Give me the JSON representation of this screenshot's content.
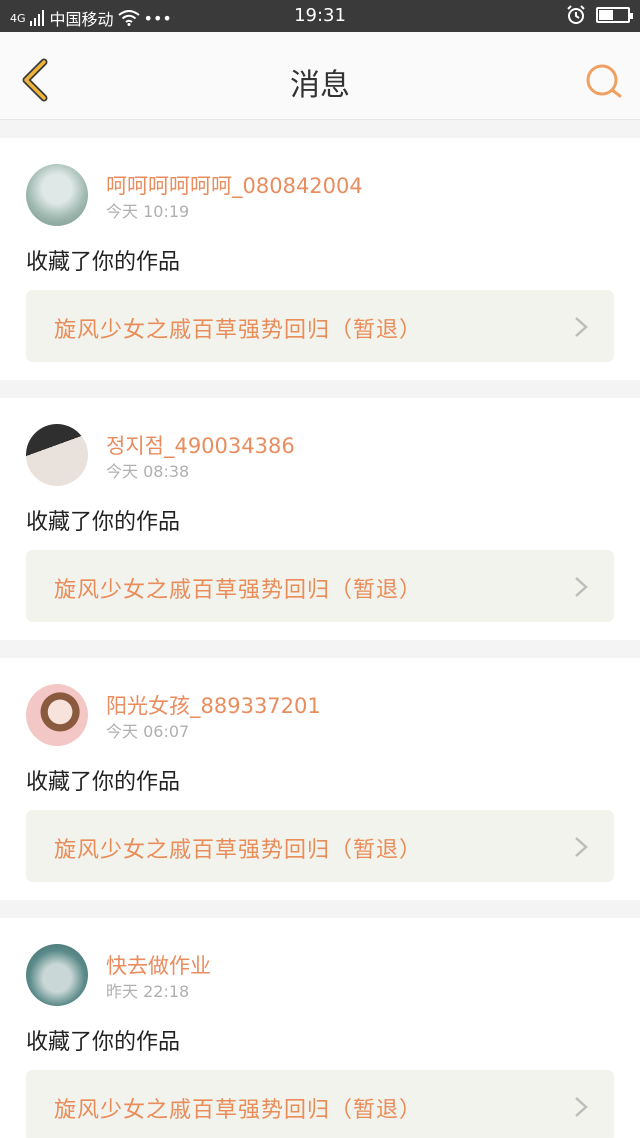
{
  "status_bar": {
    "network": "4G",
    "carrier": "中国移动",
    "more": "•••",
    "time": "19:31"
  },
  "nav": {
    "title": "消息"
  },
  "messages": [
    {
      "name": "呵呵呵呵呵呵_080842004",
      "time": "今天 10:19",
      "action": "收藏了你的作品",
      "work_title": "旋风少女之戚百草强势回归（暂退）",
      "avatar_colors": [
        "#9fb8b0",
        "#dfe8e6"
      ]
    },
    {
      "name": "정지점_490034386",
      "time": "今天 08:38",
      "action": "收藏了你的作品",
      "work_title": "旋风少女之戚百草强势回归（暂退）",
      "avatar_colors": [
        "#3b3b3b",
        "#e9e2dc"
      ]
    },
    {
      "name": "阳光女孩_889337201",
      "time": "今天 06:07",
      "action": "收藏了你的作品",
      "work_title": "旋风少女之戚百草强势回归（暂退）",
      "avatar_colors": [
        "#f2c7c5",
        "#8a5a3e"
      ]
    },
    {
      "name": "快去做作业",
      "time": "昨天 22:18",
      "action": "收藏了你的作品",
      "work_title": "旋风少女之戚百草强势回归（暂退）",
      "avatar_colors": [
        "#5b8a8a",
        "#c9d8d6"
      ]
    }
  ],
  "colors": {
    "accent": "#e98d5f",
    "back_icon": "#f0b33a",
    "search_icon": "#f0a060"
  }
}
